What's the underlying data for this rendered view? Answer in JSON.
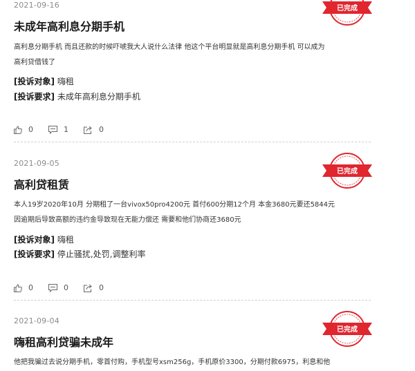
{
  "stamp_label": "已完成",
  "colors": {
    "stamp": "#e0262f",
    "date": "#8a8a8a",
    "divider": "#cfcfcf"
  },
  "posts": [
    {
      "date": "2021-09-16",
      "title": "未成年高利息分期手机",
      "body": [
        "高利息分期手机 而且还款的时候吓唬我大人说什么法律 他这个平台明显就是高利息分期手机 可以成为",
        "高利贷借钱了"
      ],
      "target_label": "[投诉对象]",
      "target": "嗨租",
      "demand_label": "[投诉要求]",
      "demand": "未成年高利息分期手机",
      "likes": "0",
      "comments": "1",
      "shares": "0"
    },
    {
      "date": "2021-09-05",
      "title": "高利贷租赁",
      "body": [
        "本人19岁2020年10月 分期租了一台vivox50pro4200元 首付600分期12个月 本金3680元要还5844元",
        "因逾期后导致高额的违约金导致现在无能力偿还 需要和他们协商还3680元"
      ],
      "target_label": "[投诉对象]",
      "target": "嗨租",
      "demand_label": "[投诉要求]",
      "demand": "停止骚扰,处罚,调整利率",
      "likes": "0",
      "comments": "0",
      "shares": "0"
    },
    {
      "date": "2021-09-04",
      "title": "嗨租高利贷骗未成年",
      "body": [
        "他把我骗过去说分期手机，零首付购，手机型号xsm256g，手机原价3300，分期付款6975，利息和他"
      ]
    }
  ]
}
